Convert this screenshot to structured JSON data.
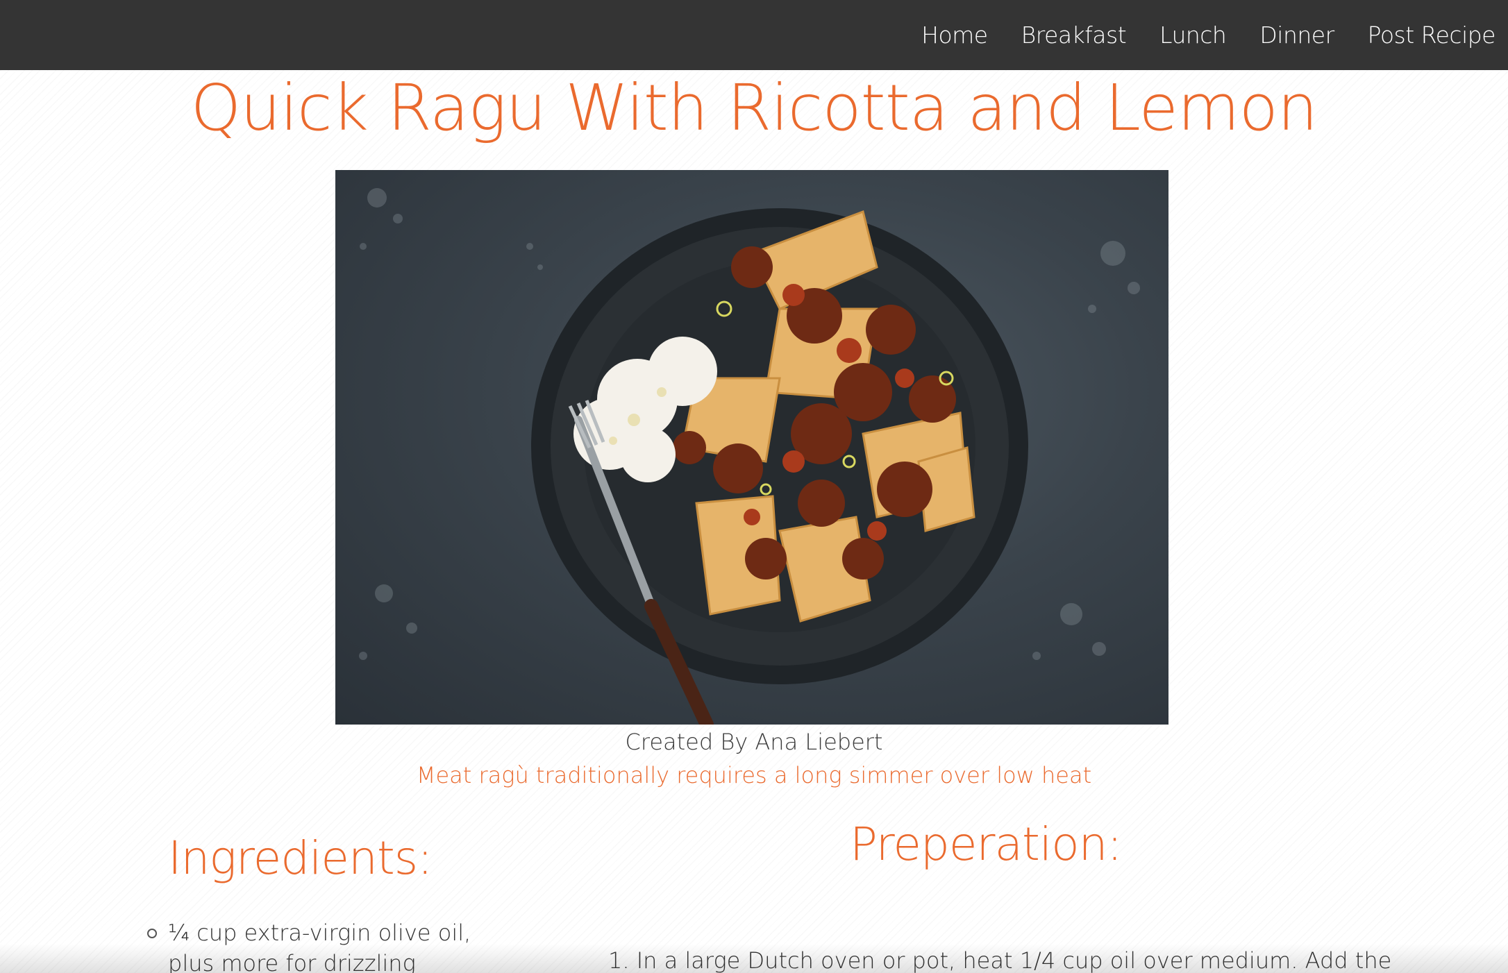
{
  "nav": {
    "items": [
      {
        "label": "Home"
      },
      {
        "label": "Breakfast"
      },
      {
        "label": "Lunch"
      },
      {
        "label": "Dinner"
      },
      {
        "label": "Post Recipe"
      }
    ]
  },
  "recipe": {
    "title": "Quick Ragu With Ricotta and Lemon",
    "author": "Created By Ana Liebert",
    "summary": "Meat ragù traditionally requires a long simmer over low heat",
    "ingredients_heading": "Ingredients:",
    "preparation_heading": "Preperation:",
    "ingredients": [
      "¼ cup extra-virgin olive oil, plus more for drizzling"
    ],
    "steps": [
      "1. In a large Dutch oven or pot, heat 1/4 cup oil over medium. Add the"
    ]
  },
  "colors": {
    "accent": "#ea6a2e",
    "navbar": "#343434",
    "text": "#333333"
  },
  "icons": {
    "bullet": "hollow-circle-icon"
  }
}
